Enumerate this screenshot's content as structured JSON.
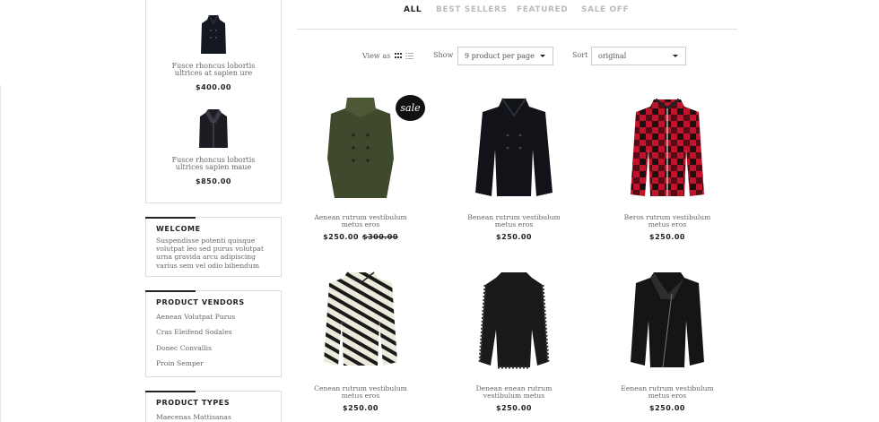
{
  "sidebar": {
    "featured": [
      {
        "title": "Fusce rhoncus lobortis ultrices at sapien ure",
        "price": "$400.00",
        "icon": "coat-icon"
      },
      {
        "title": "Fusce rhoncus lobortis ultrices sapien maue",
        "price": "$850.00",
        "icon": "jacket-icon"
      }
    ],
    "welcome": {
      "title": "WELCOME",
      "text": "Suspendisse potenti quisque volutpat leo sed purus volutpat urna gravida arcu adipiscing varius sem vel odio bibendum"
    },
    "vendors": {
      "title": "PRODUCT VENDORS",
      "items": [
        "Aenean Volutpat Purus",
        "Cras Eleifend Sodales",
        "Donec Convallis",
        "Proin Semper"
      ]
    },
    "types": {
      "title": "PRODUCT TYPES",
      "items": [
        "Maecenas Mattisanas"
      ]
    }
  },
  "tabs": [
    "ALL",
    "BEST SELLERS",
    "FEATURED",
    "SALE OFF"
  ],
  "toolbar": {
    "view_label": "View as",
    "show_label": "Show",
    "show_value": "9 product per page",
    "sort_label": "Sort",
    "sort_value": "original"
  },
  "products": [
    {
      "title": "Aenean rutrum vestibulum metus eros",
      "price": "$250.00",
      "old_price": "$300.00",
      "badge": "sale",
      "color": "#3f4a2c",
      "icon": "green-coat-icon"
    },
    {
      "title": "Benean rutrum vestibulum metus eros",
      "price": "$250.00",
      "color": "#121319",
      "icon": "black-peacoat-icon"
    },
    {
      "title": "Beros rutrum vestibulum metus eros",
      "price": "$250.00",
      "color": "#c1142c",
      "icon": "plaid-jacket-icon"
    },
    {
      "title": "Cenean rutrum vestibulum metus eros",
      "price": "$250.00",
      "color": "#e8e6dc",
      "icon": "zebra-jacket-icon"
    },
    {
      "title": "Denean enean rutrum vestibulum metus",
      "price": "$250.00",
      "color": "#1a1a1a",
      "icon": "fur-coat-icon"
    },
    {
      "title": "Eenean rutrum vestibulum metus eros",
      "price": "$250.00",
      "color": "#151515",
      "icon": "biker-jacket-icon"
    }
  ]
}
